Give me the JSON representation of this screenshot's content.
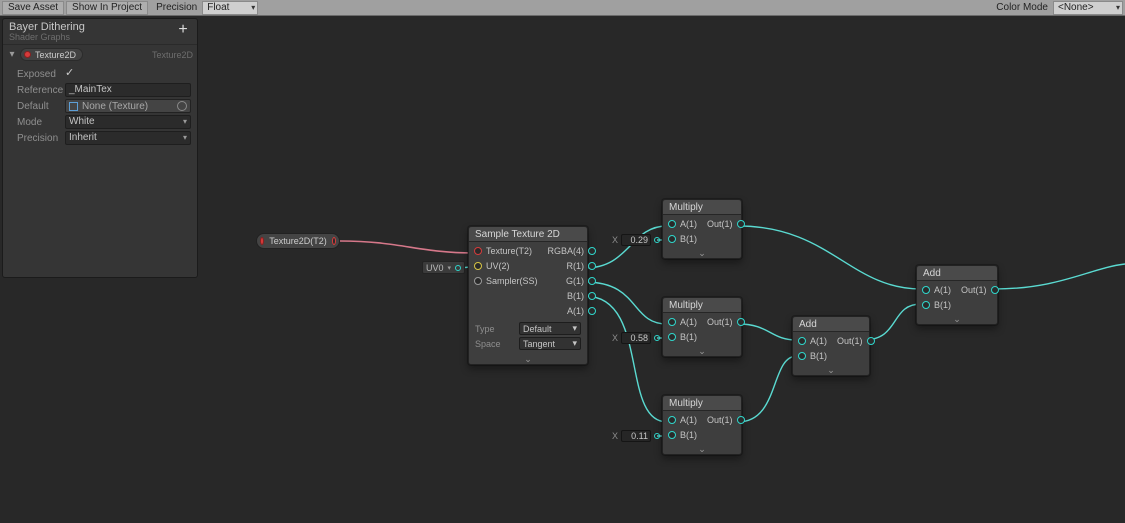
{
  "toolbar": {
    "save": "Save Asset",
    "show": "Show In Project",
    "precision_label": "Precision",
    "precision_value": "Float",
    "color_mode_label": "Color Mode",
    "color_mode_value": "<None>"
  },
  "blackboard": {
    "title": "Bayer Dithering",
    "subtitle": "Shader Graphs",
    "add_label": "+",
    "property": {
      "name": "Texture2D",
      "type": "Texture2D"
    },
    "rows": {
      "exposed": {
        "label": "Exposed",
        "checked": "✓"
      },
      "reference": {
        "label": "Reference",
        "value": "_MainTex"
      },
      "default": {
        "label": "Default",
        "value": "None (Texture)"
      },
      "mode": {
        "label": "Mode",
        "value": "White"
      },
      "precision": {
        "label": "Precision",
        "value": "Inherit"
      }
    }
  },
  "propchip": {
    "label": "Texture2D(T2)"
  },
  "uvchip": {
    "label": "UV0"
  },
  "nodes": {
    "sample": {
      "title": "Sample Texture 2D",
      "in": {
        "tex": "Texture(T2)",
        "uv": "UV(2)",
        "ss": "Sampler(SS)"
      },
      "out": {
        "rgba": "RGBA(4)",
        "r": "R(1)",
        "g": "G(1)",
        "b": "B(1)",
        "a": "A(1)"
      },
      "opts": {
        "type_l": "Type",
        "type_v": "Default",
        "space_l": "Space",
        "space_v": "Tangent"
      }
    },
    "mul1": {
      "title": "Multiply",
      "a": "A(1)",
      "b": "B(1)",
      "out": "Out(1)"
    },
    "mul2": {
      "title": "Multiply",
      "a": "A(1)",
      "b": "B(1)",
      "out": "Out(1)"
    },
    "mul3": {
      "title": "Multiply",
      "a": "A(1)",
      "b": "B(1)",
      "out": "Out(1)"
    },
    "add1": {
      "title": "Add",
      "a": "A(1)",
      "b": "B(1)",
      "out": "Out(1)"
    },
    "add2": {
      "title": "Add",
      "a": "A(1)",
      "b": "B(1)",
      "out": "Out(1)"
    }
  },
  "vals": {
    "v1": {
      "x": "X",
      "val": "0.29"
    },
    "v2": {
      "x": "X",
      "val": "0.58"
    },
    "v3": {
      "x": "X",
      "val": "0.11"
    }
  }
}
